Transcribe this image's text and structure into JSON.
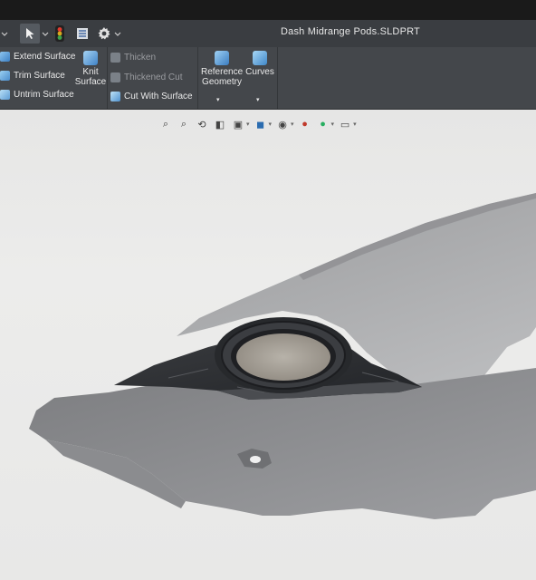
{
  "window": {
    "title": "Dash Midrange Pods.SLDPRT"
  },
  "quick_access": {
    "icons": [
      "select-arrow-icon",
      "traffic-light-icon",
      "options-list-icon",
      "gear-icon"
    ]
  },
  "ribbon": {
    "surface_tools": [
      "Extend Surface",
      "Trim Surface",
      "Untrim Surface"
    ],
    "knit_surface": "Knit\nSurface",
    "knit_line1": "Knit",
    "knit_line2": "Surface",
    "thicken": "Thicken",
    "thickened_cut": "Thickened Cut",
    "cut_with_surface": "Cut With Surface",
    "ref_line1": "Reference",
    "ref_line2": "Geometry",
    "curves": "Curves"
  },
  "colors": {
    "ribbon_bg": "#44474b",
    "titlebar_bg": "#3a3d41",
    "viewport_bg": "#e8e8e7",
    "pod_dark": "#2d2f32",
    "speaker_grille": "#a8a39b"
  }
}
